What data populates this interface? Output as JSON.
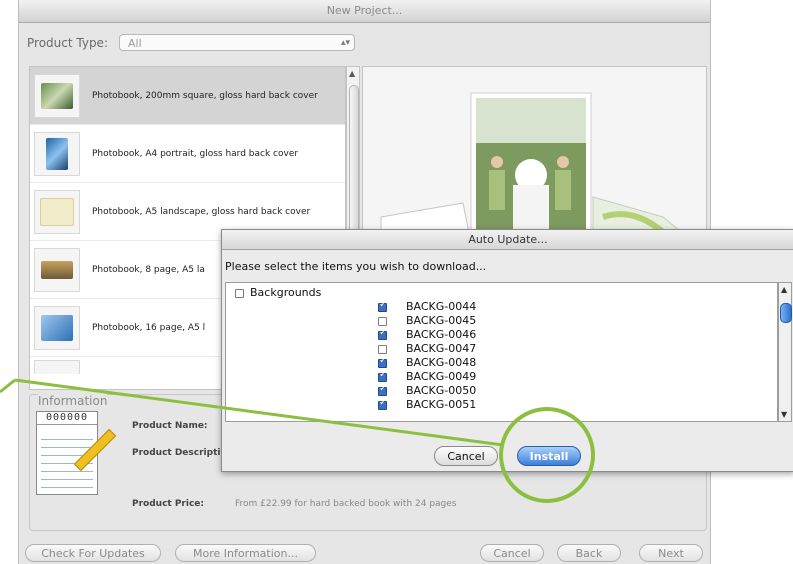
{
  "window": {
    "title": "New Project..."
  },
  "product_type": {
    "label": "Product Type:",
    "value": "All"
  },
  "products": [
    {
      "label": "Photobook, 200mm square, gloss hard back cover",
      "selected": true
    },
    {
      "label": "Photobook, A4 portrait, gloss hard back cover",
      "selected": false
    },
    {
      "label": "Photobook, A5 landscape, gloss hard back cover",
      "selected": false
    },
    {
      "label": "Photobook, 8 page, A5 la",
      "selected": false
    },
    {
      "label": "Photobook, 16 page, A5 l",
      "selected": false
    }
  ],
  "information": {
    "title": "Information",
    "notepad_text": "000000",
    "product_name_label": "Product Name:",
    "product_description_label": "Product Descriptio",
    "product_price_label": "Product Price:",
    "product_price_value": "From £22.99 for hard backed book with 24 pages"
  },
  "footer": {
    "check_updates": "Check For Updates",
    "more_info": "More Information...",
    "cancel": "Cancel",
    "back": "Back",
    "next": "Next"
  },
  "dialog": {
    "title": "Auto Update...",
    "prompt": "Please select the items you wish to download...",
    "group": {
      "label": "Backgrounds",
      "checked": false
    },
    "items": [
      {
        "label": "BACKG-0044",
        "checked": true
      },
      {
        "label": "BACKG-0045",
        "checked": false
      },
      {
        "label": "BACKG-0046",
        "checked": true
      },
      {
        "label": "BACKG-0047",
        "checked": false
      },
      {
        "label": "BACKG-0048",
        "checked": true
      },
      {
        "label": "BACKG-0049",
        "checked": true
      },
      {
        "label": "BACKG-0050",
        "checked": true
      },
      {
        "label": "BACKG-0051",
        "checked": true
      }
    ],
    "cancel": "Cancel",
    "install": "Install"
  },
  "colors": {
    "annotation": "#8cbf3f",
    "accent_blue": "#3b7fd9"
  }
}
